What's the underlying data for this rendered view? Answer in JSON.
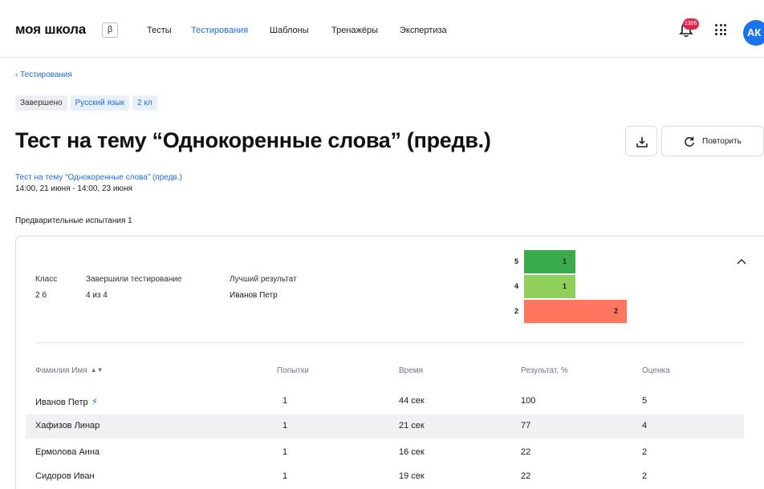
{
  "header": {
    "logo": "моя школа",
    "beta": "β",
    "nav": [
      "Тесты",
      "Тестирования",
      "Шаблоны",
      "Тренажёры",
      "Экспертиза"
    ],
    "active_nav": "Тестирования",
    "notifications_count": "1306",
    "avatar_initials": "АК",
    "accent_color": "#1f6be0"
  },
  "breadcrumb": "‹  Тестирования",
  "tags": [
    "Завершено",
    "Русский язык",
    "2 кл"
  ],
  "title": "Тест на тему “Однокоренные слова” (предв.)",
  "actions": {
    "download_icon": "download-icon",
    "repeat_label": "Повторить"
  },
  "subtitle_link": "Тест на тему “Однокоренные слова” (предв.)",
  "subtitle_dates": "14:00, 21 июня - 14:00, 23 июня",
  "section_label": "Предварительные испытания 1",
  "summary": {
    "class_label": "Класс",
    "class_value": "2 б",
    "finished_label": "Завершили тестирование",
    "finished_value": "4 из 4",
    "best_label": "Лучший результат",
    "best_value": "Иванов Петр"
  },
  "chart_data": {
    "type": "bar",
    "orientation": "horizontal",
    "categories": [
      "5",
      "4",
      "2"
    ],
    "values": [
      1,
      1,
      2
    ],
    "colors": [
      "#3aab4b",
      "#8fd05b",
      "#ff7660"
    ],
    "xlim": [
      0,
      2
    ]
  },
  "table": {
    "columns": [
      "Фамилия Имя",
      "Попытки",
      "Время",
      "Результат, %",
      "Оценка"
    ],
    "rows": [
      {
        "name": "Иванов Петр",
        "attempts": "1",
        "time": "44 сек",
        "result": "100",
        "grade": "5",
        "best": true
      },
      {
        "name": "Хафизов Линар",
        "attempts": "1",
        "time": "21 сек",
        "result": "77",
        "grade": "4"
      },
      {
        "name": "Ермолова Анна",
        "attempts": "1",
        "time": "16 сек",
        "result": "22",
        "grade": "2"
      },
      {
        "name": "Сидоров Иван",
        "attempts": "1",
        "time": "19 сек",
        "result": "22",
        "grade": "2"
      }
    ]
  }
}
